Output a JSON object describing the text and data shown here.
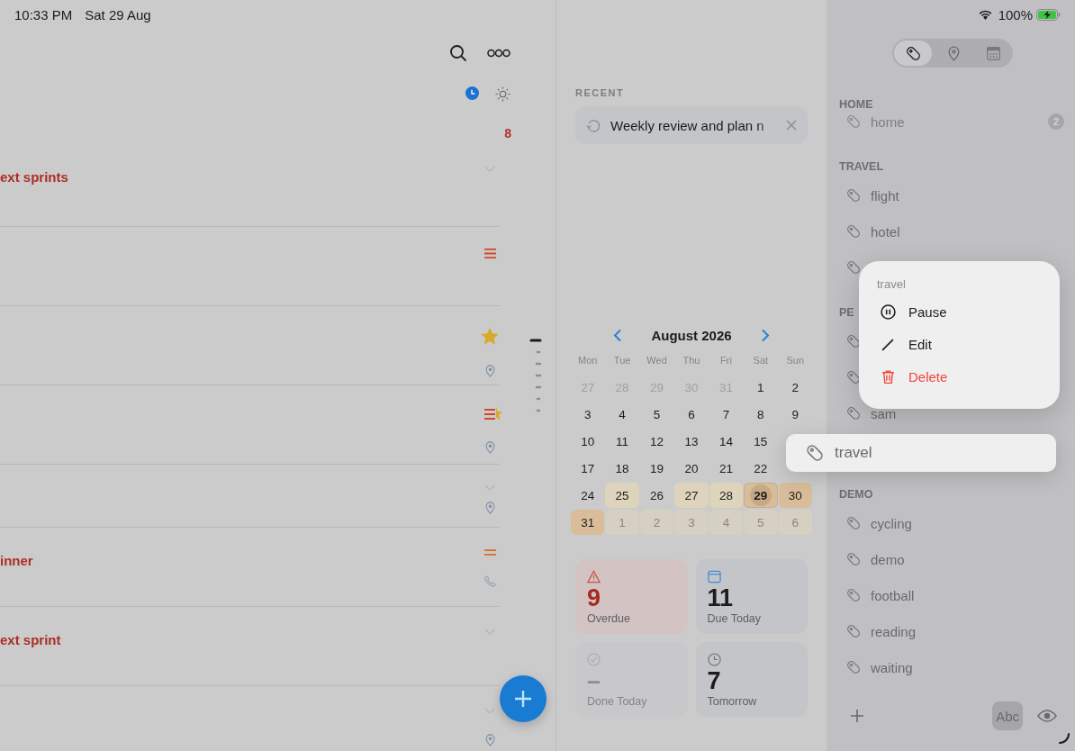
{
  "status_bar": {
    "time": "10:33 PM",
    "date": "Sat 29 Aug",
    "battery": "100%"
  },
  "task_list": {
    "count": "8",
    "tasks": [
      {
        "title": "ext sprints",
        "icons": [
          {
            "kind": "chevron"
          }
        ]
      },
      {
        "icons": [
          {
            "kind": "priority-high"
          }
        ]
      },
      {
        "icons": [
          {
            "kind": "star"
          },
          {
            "kind": "pin"
          }
        ]
      },
      {
        "icons": [
          {
            "kind": "priority-star"
          },
          {
            "kind": "pin"
          }
        ]
      },
      {
        "icons": [
          {
            "kind": "chevron"
          },
          {
            "kind": "pin"
          }
        ]
      },
      {
        "title": "inner",
        "icons": [
          {
            "kind": "priority-medium"
          },
          {
            "kind": "phone"
          }
        ]
      },
      {
        "title": "ext sprint",
        "icons": [
          {
            "kind": "chevron"
          }
        ]
      },
      {
        "icons": [
          {
            "kind": "chevron"
          },
          {
            "kind": "pin"
          }
        ]
      }
    ]
  },
  "recent": {
    "heading": "RECENT",
    "items": [
      {
        "text": "Weekly review and plan n"
      }
    ]
  },
  "calendar": {
    "month": "August 2026",
    "weekdays": [
      "Mon",
      "Tue",
      "Wed",
      "Thu",
      "Fri",
      "Sat",
      "Sun"
    ],
    "weeks": [
      [
        {
          "day": "27",
          "outside": true,
          "selected": false
        },
        {
          "day": "28",
          "outside": true,
          "selected": false
        },
        {
          "day": "29",
          "outside": true,
          "selected": false
        },
        {
          "day": "30",
          "outside": true,
          "selected": false
        },
        {
          "day": "31",
          "outside": true,
          "selected": false
        },
        {
          "day": "1",
          "outside": false,
          "selected": false
        },
        {
          "day": "2",
          "outside": false,
          "selected": false
        }
      ],
      [
        {
          "day": "3",
          "outside": false,
          "selected": false
        },
        {
          "day": "4",
          "outside": false,
          "selected": false
        },
        {
          "day": "5",
          "outside": false,
          "selected": false
        },
        {
          "day": "6",
          "outside": false,
          "selected": false
        },
        {
          "day": "7",
          "outside": false,
          "selected": false
        },
        {
          "day": "8",
          "outside": false,
          "selected": false
        },
        {
          "day": "9",
          "outside": false,
          "selected": false
        }
      ],
      [
        {
          "day": "10",
          "outside": false,
          "selected": false
        },
        {
          "day": "11",
          "outside": false,
          "selected": false
        },
        {
          "day": "12",
          "outside": false,
          "selected": false
        },
        {
          "day": "13",
          "outside": false,
          "selected": false
        },
        {
          "day": "14",
          "outside": false,
          "selected": false
        },
        {
          "day": "15",
          "outside": false,
          "selected": false
        }
      ],
      [
        {
          "day": "17",
          "outside": false,
          "selected": false
        },
        {
          "day": "18",
          "outside": false,
          "selected": false
        },
        {
          "day": "19",
          "outside": false,
          "selected": false
        },
        {
          "day": "20",
          "outside": false,
          "selected": false
        },
        {
          "day": "21",
          "outside": false,
          "selected": false
        },
        {
          "day": "22",
          "outside": false,
          "selected": false
        }
      ],
      [
        {
          "day": "24",
          "outside": false,
          "selected": false
        },
        {
          "day": "25",
          "outside": false,
          "selected": false,
          "color": "#ddd4bb"
        },
        {
          "day": "26",
          "outside": false,
          "selected": false
        },
        {
          "day": "27",
          "outside": false,
          "selected": false,
          "color": "#ddd4bb"
        },
        {
          "day": "28",
          "outside": false,
          "selected": false,
          "color": "#ddd4bb"
        },
        {
          "day": "29",
          "outside": false,
          "selected": true,
          "color": "#d9bd9a"
        },
        {
          "day": "30",
          "outside": false,
          "selected": false,
          "color": "#d9bd9a"
        }
      ],
      [
        {
          "day": "31",
          "outside": false,
          "selected": false,
          "color": "#d9bd9a"
        },
        {
          "day": "1",
          "outside": true,
          "selected": false,
          "color": "#d6d0c2"
        },
        {
          "day": "2",
          "outside": true,
          "selected": false,
          "color": "#d6d0c2"
        },
        {
          "day": "3",
          "outside": true,
          "selected": false,
          "color": "#d6d0c2"
        },
        {
          "day": "4",
          "outside": true,
          "selected": false,
          "color": "#d6d0c2"
        },
        {
          "day": "5",
          "outside": true,
          "selected": false,
          "color": "#d6d0c2"
        },
        {
          "day": "6",
          "outside": true,
          "selected": false,
          "color": "#d6d0c2"
        }
      ]
    ]
  },
  "stat_rows": [
    [
      {
        "kind": "overdue",
        "value": "9",
        "label": "Overdue"
      },
      {
        "kind": "due",
        "value": "11",
        "label": "Due Today"
      }
    ],
    [
      {
        "kind": "done",
        "value": "–",
        "label": "Done Today"
      },
      {
        "kind": "tomorrow",
        "value": "7",
        "label": "Tomorrow"
      }
    ]
  ],
  "sidebar": {
    "segments": [
      {
        "kind": "tag",
        "selected": true
      },
      {
        "kind": "pin",
        "selected": false
      },
      {
        "kind": "calendar",
        "selected": false
      }
    ],
    "sections": [
      {
        "heading": "HOME",
        "faded": true,
        "items": [
          {
            "kind": "tag",
            "label": "home",
            "count": "2"
          }
        ]
      },
      {
        "heading": "TRAVEL",
        "faded": false,
        "items": [
          {
            "kind": "tag",
            "label": "flight"
          },
          {
            "kind": "tag",
            "label": "hotel"
          },
          {
            "kind": "tag"
          }
        ]
      },
      {
        "heading": "PE",
        "faded": false,
        "items": [
          {
            "kind": "tag"
          },
          {
            "kind": "tag"
          },
          {
            "kind": "tag",
            "label": "sam"
          },
          {
            "kind": "drop-slot"
          }
        ]
      },
      {
        "heading": "DEMO",
        "faded": false,
        "items": [
          {
            "kind": "tag",
            "label": "cycling"
          },
          {
            "kind": "tag",
            "label": "demo"
          },
          {
            "kind": "tag",
            "label": "football"
          },
          {
            "kind": "tag",
            "label": "reading"
          },
          {
            "kind": "tag",
            "label": "waiting"
          }
        ]
      }
    ],
    "footer": {
      "sort_label": "Abc",
      "sort_selected": true
    }
  },
  "context_menu": {
    "title": "travel",
    "items": [
      {
        "kind": "pause",
        "label": "Pause"
      },
      {
        "kind": "edit",
        "label": "Edit"
      },
      {
        "kind": "delete",
        "label": "Delete"
      }
    ]
  },
  "dragging": {
    "label": "travel"
  }
}
